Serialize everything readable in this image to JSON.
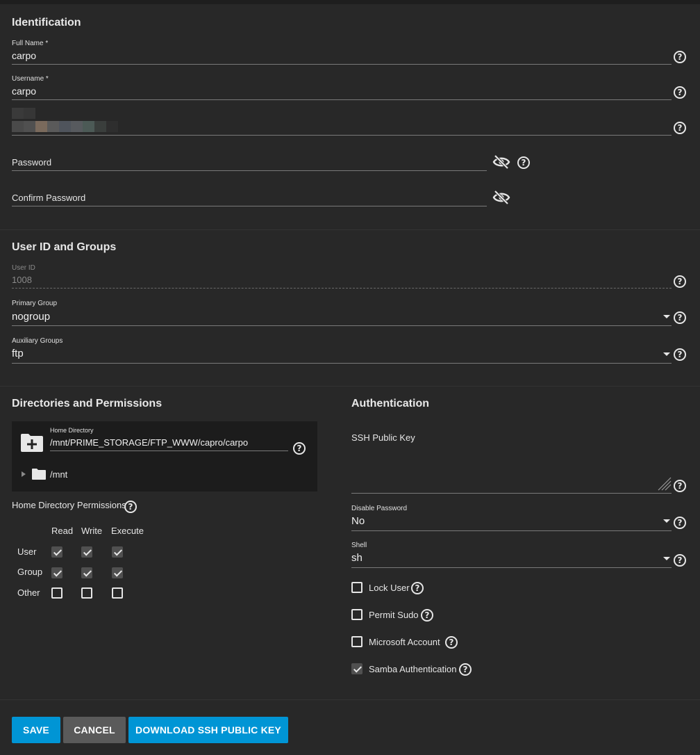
{
  "identification": {
    "title": "Identification",
    "full_name_label": "Full Name *",
    "full_name_value": "carpo",
    "username_label": "Username *",
    "username_value": "carpo",
    "password_placeholder": "Password",
    "confirm_password_placeholder": "Confirm Password"
  },
  "user_id_groups": {
    "title": "User ID and Groups",
    "user_id_label": "User ID",
    "user_id_value": "1008",
    "primary_group_label": "Primary Group",
    "primary_group_value": "nogroup",
    "aux_groups_label": "Auxiliary Groups",
    "aux_groups_value": "ftp"
  },
  "directories": {
    "title": "Directories and Permissions",
    "home_dir_label": "Home Directory",
    "home_dir_value": "/mnt/PRIME_STORAGE/FTP_WWW/capro/carpo",
    "tree_root": "/mnt",
    "permissions_label": "Home Directory Permissions",
    "columns": [
      "Read",
      "Write",
      "Execute"
    ],
    "rows": [
      {
        "label": "User",
        "checked": [
          true,
          true,
          true
        ]
      },
      {
        "label": "Group",
        "checked": [
          true,
          true,
          true
        ]
      },
      {
        "label": "Other",
        "checked": [
          false,
          false,
          false
        ]
      }
    ]
  },
  "authentication": {
    "title": "Authentication",
    "ssh_key_label": "SSH Public Key",
    "disable_password_label": "Disable Password",
    "disable_password_value": "No",
    "shell_label": "Shell",
    "shell_value": "sh",
    "lock_user_label": "Lock User",
    "lock_user_checked": false,
    "permit_sudo_label": "Permit Sudo",
    "permit_sudo_checked": false,
    "microsoft_account_label": "Microsoft Account",
    "microsoft_account_checked": false,
    "samba_auth_label": "Samba Authentication",
    "samba_auth_checked": true
  },
  "actions": {
    "save": "SAVE",
    "cancel": "CANCEL",
    "download_key": "DOWNLOAD SSH PUBLIC KEY"
  },
  "icons": {
    "help": "help-circle-icon",
    "eye_off": "eye-off-icon",
    "dropdown": "caret-down-icon",
    "folder_add": "folder-plus-icon",
    "folder": "folder-icon",
    "expand": "triangle-right-icon"
  },
  "colors": {
    "primary_button": "#0095d5",
    "secondary_button": "#5a5a5a",
    "card_background": "#282828"
  }
}
